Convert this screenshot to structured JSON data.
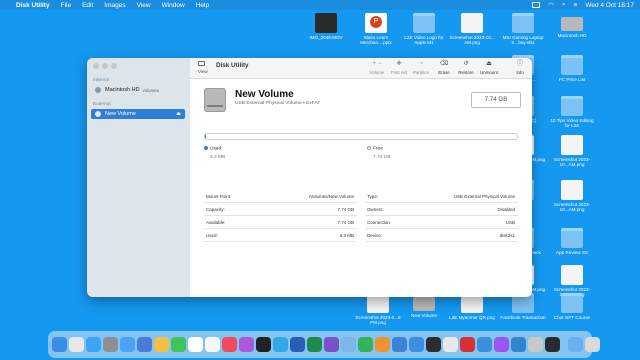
{
  "menubar": {
    "apple_icon": "apple-icon",
    "app_name": "Disk Utility",
    "items": [
      "File",
      "Edit",
      "Images",
      "View",
      "Window",
      "Help"
    ],
    "clock": "Wed 4 Oct  18:17"
  },
  "desktop": {
    "icons": [
      {
        "label": "IMG_2049.MOV",
        "kind": "img-dark"
      },
      {
        "label": "Waso Learn Merchan....pptx",
        "kind": "doc-red"
      },
      {
        "label": "L2E Video Logo for Apple M1",
        "kind": "folder"
      },
      {
        "label": "Screenshot 2023-10... AM.png",
        "kind": "file"
      },
      {
        "label": "MSI Gaming Laptop S...bay.xlsx",
        "kind": "folder"
      },
      {
        "label": "Macintosh HD",
        "kind": "disk"
      },
      {
        "label": "marketing ...",
        "kind": "folder"
      },
      {
        "label": "PC Price List",
        "kind": "folder"
      },
      {
        "label": "Creator ...(C)",
        "kind": "folder"
      },
      {
        "label": "10 Tips Video Editing for L2E",
        "kind": "folder"
      },
      {
        "label": "Screenshot ...AM.png",
        "kind": "file"
      },
      {
        "label": "Screenshot 2023-10...AM.png",
        "kind": "file"
      },
      {
        "label": "...English",
        "kind": "folder"
      },
      {
        "label": "Screenshot 2023-10...AM.png",
        "kind": "file"
      },
      {
        "label": "Book Ads ...etack",
        "kind": "folder"
      },
      {
        "label": "App Review SS",
        "kind": "folder"
      },
      {
        "label": "Screenshot ...AM.png",
        "kind": "file"
      },
      {
        "label": "Screenshot 2023-10...AM.png",
        "kind": "file"
      },
      {
        "label": "Screenshot 2023-0...8 PM.png",
        "kind": "file"
      },
      {
        "label": "New Volume",
        "kind": "disk"
      },
      {
        "label": "L2E Myanmar QR.png",
        "kind": "file"
      },
      {
        "label": "Facebook Transaction",
        "kind": "folder"
      },
      {
        "label": "Chat GPT Course",
        "kind": "folder"
      }
    ]
  },
  "window": {
    "title": "Disk Utility",
    "view_label": "View",
    "sidebar": {
      "internal_label": "Internal",
      "external_label": "External",
      "internal_item": {
        "label": "Macintosh HD",
        "sub": "volumes"
      },
      "external_item": {
        "label": "New Volume",
        "eject": "⏏"
      }
    },
    "toolbar": [
      {
        "label": "Volume",
        "glyph": "+ −",
        "enabled": false
      },
      {
        "label": "First Aid",
        "glyph": "✚",
        "enabled": false
      },
      {
        "label": "Partition",
        "glyph": "◔",
        "enabled": false
      },
      {
        "label": "Erase",
        "glyph": "⌫",
        "enabled": true
      },
      {
        "label": "Restore",
        "glyph": "↺",
        "enabled": true
      },
      {
        "label": "Unmount",
        "glyph": "⏏",
        "enabled": true
      },
      {
        "label": "Info",
        "glyph": "ⓘ",
        "enabled": true
      }
    ],
    "volume": {
      "name": "New Volume",
      "subtitle": "USB External Physical Volume • ExFAT",
      "size": "7.74 GB",
      "used_fraction": 0.0007
    },
    "usage": {
      "used_label": "Used",
      "used_value": "5.3 MB",
      "used_color": "#2f7ed8",
      "free_label": "Free",
      "free_value": "7.74 GB",
      "free_color": "#ffffff"
    },
    "info_left": [
      {
        "key": "Mount Point:",
        "value": "/Volumes/New Volume"
      },
      {
        "key": "Capacity:",
        "value": "7.74 GB"
      },
      {
        "key": "Available:",
        "value": "7.74 GB"
      },
      {
        "key": "Used:",
        "value": "5.3 MB"
      }
    ],
    "info_right": [
      {
        "key": "Type:",
        "value": "USB External Physical Volume"
      },
      {
        "key": "Owners:",
        "value": "Disabled"
      },
      {
        "key": "Connection:",
        "value": "USB"
      },
      {
        "key": "Device:",
        "value": "disk2s1"
      }
    ]
  },
  "dock": {
    "apps": [
      {
        "name": "finder-icon",
        "color": "#3a8ee6"
      },
      {
        "name": "launchpad-icon",
        "color": "#e8e8e8"
      },
      {
        "name": "safari-icon",
        "color": "#3ba4f6"
      },
      {
        "name": "settings-icon",
        "color": "#8e8e93"
      },
      {
        "name": "mail-icon",
        "color": "#4aa3f7"
      },
      {
        "name": "app-store-icon",
        "color": "#4a7bd8"
      },
      {
        "name": "photos-icon",
        "color": "#f3c042"
      },
      {
        "name": "facetime-icon",
        "color": "#3fc45a"
      },
      {
        "name": "calendar-icon",
        "color": "#ffffff"
      },
      {
        "name": "reminders-icon",
        "color": "#f7f7f7"
      },
      {
        "name": "music-icon",
        "color": "#f24a5c"
      },
      {
        "name": "podcasts-icon",
        "color": "#a85ad8"
      },
      {
        "name": "tv-icon",
        "color": "#222222"
      },
      {
        "name": "telegram-icon",
        "color": "#32a8e4"
      },
      {
        "name": "word-icon",
        "color": "#2b5cb8"
      },
      {
        "name": "excel-icon",
        "color": "#1f8b4c"
      },
      {
        "name": "viber-icon",
        "color": "#7a51c8"
      },
      {
        "name": "preview-icon",
        "color": "#7db6e8"
      },
      {
        "name": "numbers-icon",
        "color": "#34b45a"
      },
      {
        "name": "pages-icon",
        "color": "#f0922e"
      },
      {
        "name": "keynote-icon",
        "color": "#3b82d8"
      },
      {
        "name": "xcode-icon",
        "color": "#3a8fe0"
      },
      {
        "name": "terminal-icon",
        "color": "#2d2d2d"
      },
      {
        "name": "chrome-icon",
        "color": "#e9e9e9"
      },
      {
        "name": "opera-icon",
        "color": "#d93030"
      },
      {
        "name": "quicktime-icon",
        "color": "#3e8ee0"
      },
      {
        "name": "messenger-icon",
        "color": "#9b55f3"
      },
      {
        "name": "vscode-icon",
        "color": "#2f84d0"
      },
      {
        "name": "disk-utility-icon",
        "color": "#c8c8c8"
      },
      {
        "name": "activity-monitor-icon",
        "color": "#2b2b2b"
      },
      {
        "name": "downloads-icon",
        "color": "#6ab0f0"
      },
      {
        "name": "trash-icon",
        "color": "#dadada"
      }
    ]
  }
}
